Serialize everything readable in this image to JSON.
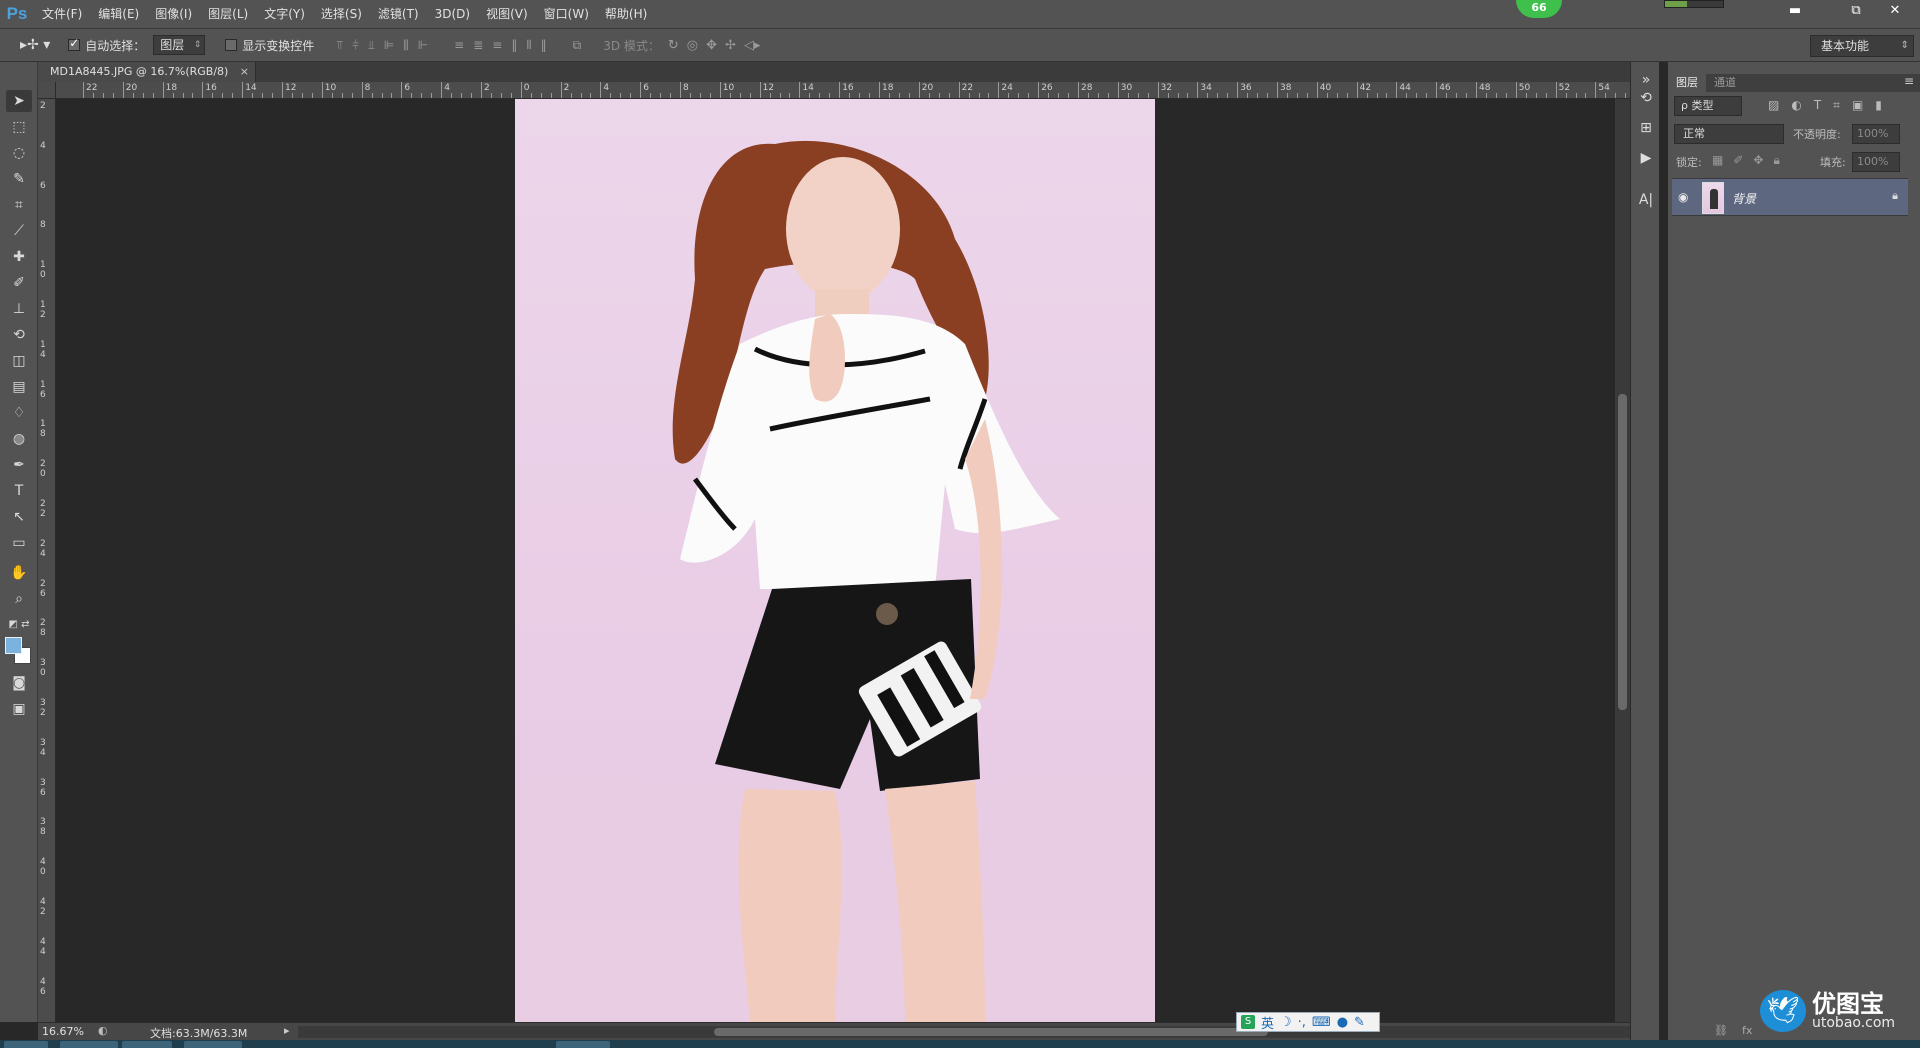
{
  "app": {
    "logo": "Ps",
    "badge": "66"
  },
  "menu": [
    "文件(F)",
    "编辑(E)",
    "图像(I)",
    "图层(L)",
    "文字(Y)",
    "选择(S)",
    "滤镜(T)",
    "3D(D)",
    "视图(V)",
    "窗口(W)",
    "帮助(H)"
  ],
  "window_controls": {
    "minimize": "▬",
    "restore": "⧉",
    "close": "✕"
  },
  "options": {
    "auto_select_label": "自动选择：",
    "auto_select_value": "图层",
    "show_transform_label": "显示变换控件",
    "mode_3d_label": "3D 模式：",
    "workspace": "基本功能"
  },
  "document": {
    "tab_title": "MD1A8445.JPG @ 16.7%(RGB/8)",
    "close": "×",
    "zoom": "16.67%",
    "doc_info": "文档:63.3M/63.3M"
  },
  "ruler_h": [
    "22",
    "20",
    "18",
    "16",
    "14",
    "12",
    "10",
    "8",
    "6",
    "4",
    "2",
    "0",
    "2",
    "4",
    "6",
    "8",
    "10",
    "12",
    "14",
    "16",
    "18",
    "20",
    "22",
    "24",
    "26",
    "28",
    "30",
    "32",
    "34",
    "36",
    "38",
    "40",
    "42",
    "44",
    "46",
    "48",
    "50",
    "52",
    "54"
  ],
  "ruler_v": [
    "2",
    "4",
    "6",
    "8",
    "1\n0",
    "1\n2",
    "1\n4",
    "1\n6",
    "1\n8",
    "2\n0",
    "2\n2",
    "2\n4",
    "2\n6",
    "2\n8",
    "3\n0",
    "3\n2",
    "3\n4",
    "3\n6",
    "3\n8",
    "4\n0",
    "4\n2",
    "4\n4",
    "4\n6"
  ],
  "layers_panel": {
    "tabs": [
      "图层",
      "通道"
    ],
    "filter": "ρ 类型",
    "blend_mode": "正常",
    "opacity_label": "不透明度:",
    "opacity_value": "100%",
    "lock_label": "锁定:",
    "fill_label": "填充:",
    "fill_value": "100%",
    "layers": [
      {
        "name": "背景",
        "visible": true,
        "locked": true
      }
    ]
  },
  "ime": {
    "lang": "英"
  },
  "watermark": {
    "brand": "优图宝",
    "url": "utobao.com"
  }
}
